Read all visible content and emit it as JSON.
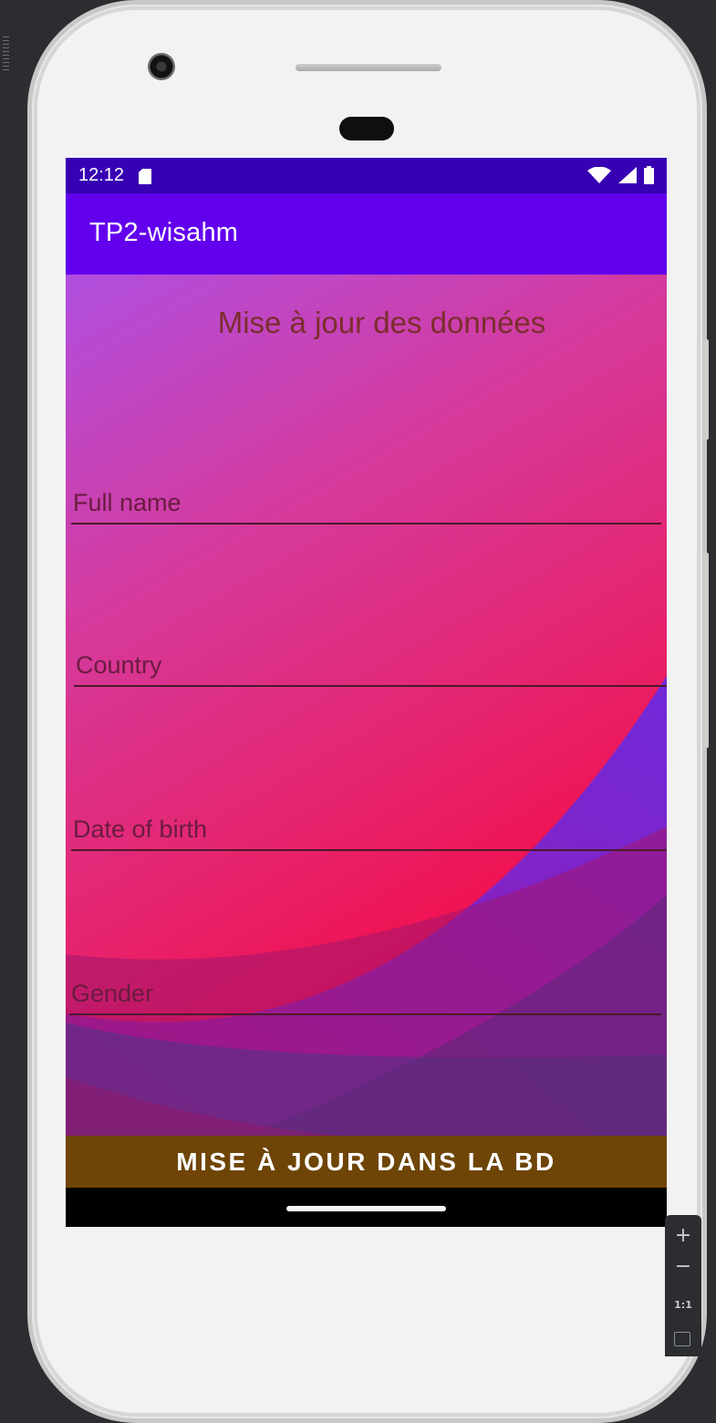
{
  "status_bar": {
    "time": "12:12",
    "icons": [
      "sd-card-icon",
      "wifi-icon",
      "signal-icon",
      "battery-icon"
    ]
  },
  "app_bar": {
    "title": "TP2-wisahm"
  },
  "form": {
    "title": "Mise à jour des données",
    "fields": [
      {
        "placeholder": "Full name",
        "value": ""
      },
      {
        "placeholder": "Country",
        "value": ""
      },
      {
        "placeholder": "Date of birth",
        "value": ""
      },
      {
        "placeholder": "Gender",
        "value": ""
      }
    ],
    "submit_label": "MISE À JOUR DANS LA BD"
  },
  "zoom_controls": {
    "plus": "+",
    "minus": "−",
    "actual_size": "1:1"
  },
  "colors": {
    "status_bar": "#3700b3",
    "app_bar": "#6200ee",
    "button": "#6e4506",
    "title_text": "#7b2d2d"
  }
}
